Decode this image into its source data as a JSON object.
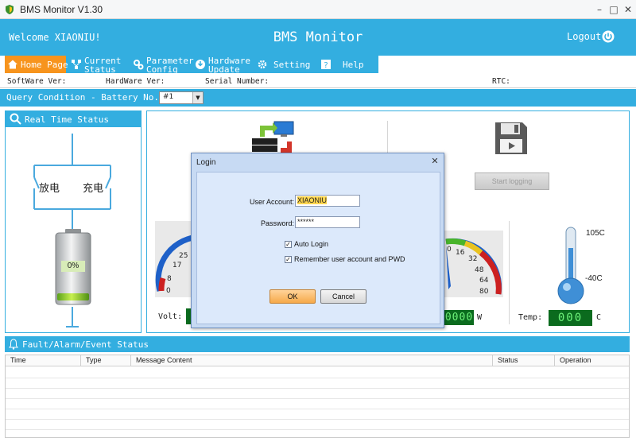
{
  "window": {
    "title": "BMS Monitor V1.30",
    "minimize": "–",
    "maximize": "□",
    "close": "✕"
  },
  "header": {
    "welcome": "Welcome XIAONIU!",
    "title": "BMS Monitor",
    "logout": "Logout"
  },
  "menu": [
    {
      "label": "Home Page",
      "icon": "home-icon",
      "active": true
    },
    {
      "label": "Current\nStatus",
      "icon": "network-icon"
    },
    {
      "label": "Parameter\nConfig",
      "icon": "gears-icon"
    },
    {
      "label": "Hardware\nUpdate",
      "icon": "update-icon"
    },
    {
      "label": "Setting",
      "icon": "gear-icon"
    },
    {
      "label": "Help",
      "icon": "help-icon"
    }
  ],
  "info": {
    "software": "SoftWare Ver:",
    "hardware": "HardWare Ver:",
    "serial": "Serial Number:",
    "rtc": "RTC:"
  },
  "query": {
    "label": "Query Condition - Battery No.:",
    "battery_selected": "#1"
  },
  "realtime": {
    "title": "Real Time Status",
    "discharge": "放电",
    "charge": "充电",
    "soc": "0%",
    "soc_fraction": 0
  },
  "dashboard": {
    "start_logging": "Start logging",
    "volt_label": "Volt:",
    "power_unit": "W",
    "power_value": "0000",
    "temp_label": "Temp:",
    "temp_value": "000",
    "temp_unit": "C",
    "therm_max": "105C",
    "therm_min": "-40C",
    "volt_gauge_ticks": [
      "25",
      "17",
      "8",
      "0"
    ],
    "power_gauge_ticks": [
      "0",
      "16",
      "32",
      "48",
      "64",
      "80"
    ],
    "power_ticks_top": "0"
  },
  "fault": {
    "title": "Fault/Alarm/Event Status",
    "columns": [
      "Time",
      "Type",
      "Message Content",
      "Status",
      "Operation"
    ]
  },
  "login": {
    "title": "Login",
    "close": "✕",
    "account_label": "User Account:",
    "account_value": "XIAONIU",
    "password_label": "Password:",
    "password_value": "******",
    "auto_login": "Auto Login",
    "auto_login_checked": true,
    "remember": "Remember user account and PWD",
    "remember_checked": true,
    "ok": "OK",
    "cancel": "Cancel"
  },
  "colors": {
    "accent": "#33aee0",
    "active_tab": "#f7941d",
    "dialog": "#dce9fb"
  }
}
